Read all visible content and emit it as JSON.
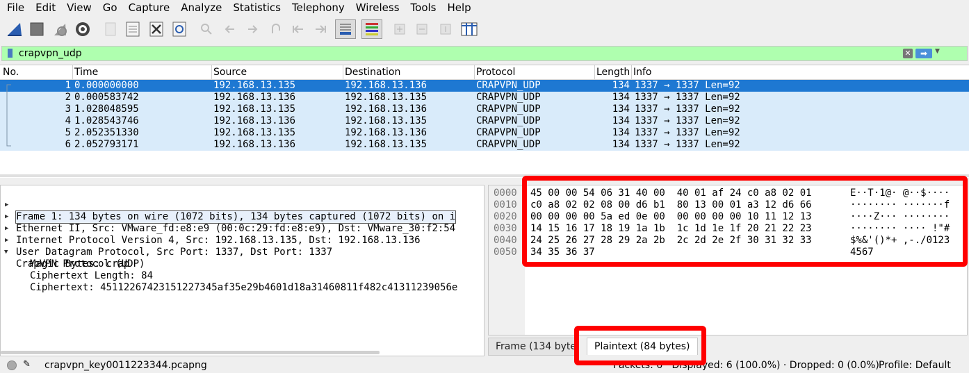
{
  "menu": [
    "File",
    "Edit",
    "View",
    "Go",
    "Capture",
    "Analyze",
    "Statistics",
    "Telephony",
    "Wireless",
    "Tools",
    "Help"
  ],
  "filter": {
    "value": "crapvpn_udp"
  },
  "packet_list": {
    "columns": [
      "No.",
      "Time",
      "Source",
      "Destination",
      "Protocol",
      "Length",
      "Info"
    ],
    "rows": [
      {
        "no": "1",
        "time": "0.000000000",
        "src": "192.168.13.135",
        "dst": "192.168.13.136",
        "proto": "CRAPVPN_UDP",
        "len": "134",
        "info": "1337 → 1337 Len=92"
      },
      {
        "no": "2",
        "time": "0.000583742",
        "src": "192.168.13.136",
        "dst": "192.168.13.135",
        "proto": "CRAPVPN_UDP",
        "len": "134",
        "info": "1337 → 1337 Len=92"
      },
      {
        "no": "3",
        "time": "1.028048595",
        "src": "192.168.13.135",
        "dst": "192.168.13.136",
        "proto": "CRAPVPN_UDP",
        "len": "134",
        "info": "1337 → 1337 Len=92"
      },
      {
        "no": "4",
        "time": "1.028543746",
        "src": "192.168.13.136",
        "dst": "192.168.13.135",
        "proto": "CRAPVPN_UDP",
        "len": "134",
        "info": "1337 → 1337 Len=92"
      },
      {
        "no": "5",
        "time": "2.052351330",
        "src": "192.168.13.135",
        "dst": "192.168.13.136",
        "proto": "CRAPVPN_UDP",
        "len": "134",
        "info": "1337 → 1337 Len=92"
      },
      {
        "no": "6",
        "time": "2.052793171",
        "src": "192.168.13.136",
        "dst": "192.168.13.135",
        "proto": "CRAPVPN_UDP",
        "len": "134",
        "info": "1337 → 1337 Len=92"
      }
    ]
  },
  "details": [
    {
      "text": "Frame 1: 134 bytes on wire (1072 bits), 134 bytes captured (1072 bits) on i",
      "expander": "collapsed"
    },
    {
      "text": "Ethernet II, Src: VMware_fd:e8:e9 (00:0c:29:fd:e8:e9), Dst: VMware_30:f2:54",
      "expander": "collapsed"
    },
    {
      "text": "Internet Protocol Version 4, Src: 192.168.13.135, Dst: 192.168.13.136",
      "expander": "collapsed"
    },
    {
      "text": "User Datagram Protocol, Src Port: 1337, Dst Port: 1337",
      "expander": "collapsed"
    },
    {
      "text": "CrapVPN Protocol (UDP)",
      "expander": "expanded"
    },
    {
      "text": "Magic Bytes: crap",
      "expander": "none"
    },
    {
      "text": "Ciphertext Length: 84",
      "expander": "none"
    },
    {
      "text": "Ciphertext: 45112267423151227345af35e29b4601d18a31460811f482c41311239056e",
      "expander": "none"
    }
  ],
  "bytes": [
    {
      "offset": "0000",
      "hex": "45 00 00 54 06 31 40 00  40 01 af 24 c0 a8 02 01",
      "ascii": "E··T·1@· @··$····"
    },
    {
      "offset": "0010",
      "hex": "c0 a8 02 02 08 00 d6 b1  80 13 00 01 a3 12 d6 66",
      "ascii": "········ ·······f"
    },
    {
      "offset": "0020",
      "hex": "00 00 00 00 5a ed 0e 00  00 00 00 00 10 11 12 13",
      "ascii": "····Z··· ········"
    },
    {
      "offset": "0030",
      "hex": "14 15 16 17 18 19 1a 1b  1c 1d 1e 1f 20 21 22 23",
      "ascii": "········ ···· !\"#"
    },
    {
      "offset": "0040",
      "hex": "24 25 26 27 28 29 2a 2b  2c 2d 2e 2f 30 31 32 33",
      "ascii": "$%&'()*+ ,-./0123"
    },
    {
      "offset": "0050",
      "hex": "34 35 36 37",
      "ascii": "4567"
    }
  ],
  "byte_tabs": {
    "frame": "Frame (134 bytes)",
    "plaintext": "Plaintext (84 bytes)"
  },
  "status": {
    "file": "crapvpn_key0011223344.pcapng",
    "packets": "Packets: 6 · Displayed: 6 (100.0%) · Dropped: 0 (0.0%)",
    "profile": "Profile: Default"
  },
  "colors": {
    "selected_row": "#1e78d2",
    "row_bg": "#d9ebfa",
    "filter_ok": "#afffaf",
    "highlight": "#ff0000"
  },
  "toolbar_icons": [
    "shark-fin-icon",
    "stop-icon",
    "restart-icon",
    "options-gear-icon",
    "open-file-icon",
    "save-file-icon",
    "close-file-icon",
    "reload-icon",
    "find-icon",
    "back-icon",
    "forward-icon",
    "goto-icon",
    "first-icon",
    "last-icon",
    "autoscroll-icon",
    "colorize-icon",
    "zoom-in-icon",
    "zoom-out-icon",
    "normal-size-icon",
    "resize-columns-icon"
  ]
}
